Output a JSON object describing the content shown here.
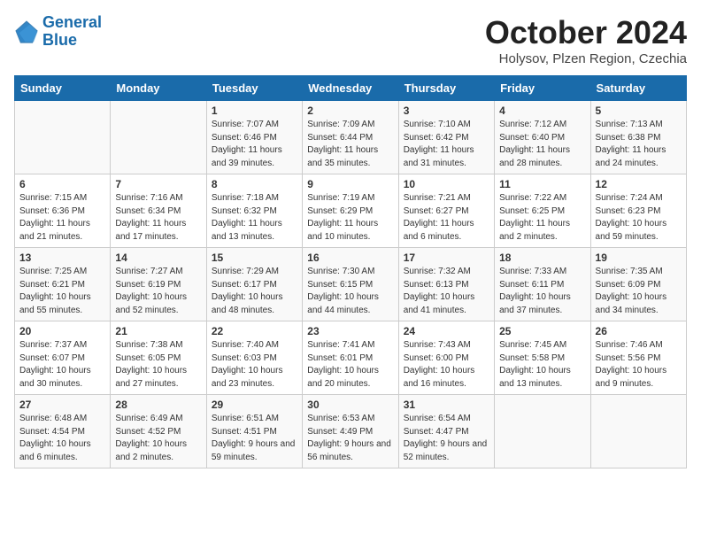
{
  "header": {
    "logo_line1": "General",
    "logo_line2": "Blue",
    "month": "October 2024",
    "location": "Holysov, Plzen Region, Czechia"
  },
  "days_of_week": [
    "Sunday",
    "Monday",
    "Tuesday",
    "Wednesday",
    "Thursday",
    "Friday",
    "Saturday"
  ],
  "weeks": [
    [
      {
        "day": "",
        "info": ""
      },
      {
        "day": "",
        "info": ""
      },
      {
        "day": "1",
        "info": "Sunrise: 7:07 AM\nSunset: 6:46 PM\nDaylight: 11 hours and 39 minutes."
      },
      {
        "day": "2",
        "info": "Sunrise: 7:09 AM\nSunset: 6:44 PM\nDaylight: 11 hours and 35 minutes."
      },
      {
        "day": "3",
        "info": "Sunrise: 7:10 AM\nSunset: 6:42 PM\nDaylight: 11 hours and 31 minutes."
      },
      {
        "day": "4",
        "info": "Sunrise: 7:12 AM\nSunset: 6:40 PM\nDaylight: 11 hours and 28 minutes."
      },
      {
        "day": "5",
        "info": "Sunrise: 7:13 AM\nSunset: 6:38 PM\nDaylight: 11 hours and 24 minutes."
      }
    ],
    [
      {
        "day": "6",
        "info": "Sunrise: 7:15 AM\nSunset: 6:36 PM\nDaylight: 11 hours and 21 minutes."
      },
      {
        "day": "7",
        "info": "Sunrise: 7:16 AM\nSunset: 6:34 PM\nDaylight: 11 hours and 17 minutes."
      },
      {
        "day": "8",
        "info": "Sunrise: 7:18 AM\nSunset: 6:32 PM\nDaylight: 11 hours and 13 minutes."
      },
      {
        "day": "9",
        "info": "Sunrise: 7:19 AM\nSunset: 6:29 PM\nDaylight: 11 hours and 10 minutes."
      },
      {
        "day": "10",
        "info": "Sunrise: 7:21 AM\nSunset: 6:27 PM\nDaylight: 11 hours and 6 minutes."
      },
      {
        "day": "11",
        "info": "Sunrise: 7:22 AM\nSunset: 6:25 PM\nDaylight: 11 hours and 2 minutes."
      },
      {
        "day": "12",
        "info": "Sunrise: 7:24 AM\nSunset: 6:23 PM\nDaylight: 10 hours and 59 minutes."
      }
    ],
    [
      {
        "day": "13",
        "info": "Sunrise: 7:25 AM\nSunset: 6:21 PM\nDaylight: 10 hours and 55 minutes."
      },
      {
        "day": "14",
        "info": "Sunrise: 7:27 AM\nSunset: 6:19 PM\nDaylight: 10 hours and 52 minutes."
      },
      {
        "day": "15",
        "info": "Sunrise: 7:29 AM\nSunset: 6:17 PM\nDaylight: 10 hours and 48 minutes."
      },
      {
        "day": "16",
        "info": "Sunrise: 7:30 AM\nSunset: 6:15 PM\nDaylight: 10 hours and 44 minutes."
      },
      {
        "day": "17",
        "info": "Sunrise: 7:32 AM\nSunset: 6:13 PM\nDaylight: 10 hours and 41 minutes."
      },
      {
        "day": "18",
        "info": "Sunrise: 7:33 AM\nSunset: 6:11 PM\nDaylight: 10 hours and 37 minutes."
      },
      {
        "day": "19",
        "info": "Sunrise: 7:35 AM\nSunset: 6:09 PM\nDaylight: 10 hours and 34 minutes."
      }
    ],
    [
      {
        "day": "20",
        "info": "Sunrise: 7:37 AM\nSunset: 6:07 PM\nDaylight: 10 hours and 30 minutes."
      },
      {
        "day": "21",
        "info": "Sunrise: 7:38 AM\nSunset: 6:05 PM\nDaylight: 10 hours and 27 minutes."
      },
      {
        "day": "22",
        "info": "Sunrise: 7:40 AM\nSunset: 6:03 PM\nDaylight: 10 hours and 23 minutes."
      },
      {
        "day": "23",
        "info": "Sunrise: 7:41 AM\nSunset: 6:01 PM\nDaylight: 10 hours and 20 minutes."
      },
      {
        "day": "24",
        "info": "Sunrise: 7:43 AM\nSunset: 6:00 PM\nDaylight: 10 hours and 16 minutes."
      },
      {
        "day": "25",
        "info": "Sunrise: 7:45 AM\nSunset: 5:58 PM\nDaylight: 10 hours and 13 minutes."
      },
      {
        "day": "26",
        "info": "Sunrise: 7:46 AM\nSunset: 5:56 PM\nDaylight: 10 hours and 9 minutes."
      }
    ],
    [
      {
        "day": "27",
        "info": "Sunrise: 6:48 AM\nSunset: 4:54 PM\nDaylight: 10 hours and 6 minutes."
      },
      {
        "day": "28",
        "info": "Sunrise: 6:49 AM\nSunset: 4:52 PM\nDaylight: 10 hours and 2 minutes."
      },
      {
        "day": "29",
        "info": "Sunrise: 6:51 AM\nSunset: 4:51 PM\nDaylight: 9 hours and 59 minutes."
      },
      {
        "day": "30",
        "info": "Sunrise: 6:53 AM\nSunset: 4:49 PM\nDaylight: 9 hours and 56 minutes."
      },
      {
        "day": "31",
        "info": "Sunrise: 6:54 AM\nSunset: 4:47 PM\nDaylight: 9 hours and 52 minutes."
      },
      {
        "day": "",
        "info": ""
      },
      {
        "day": "",
        "info": ""
      }
    ]
  ]
}
